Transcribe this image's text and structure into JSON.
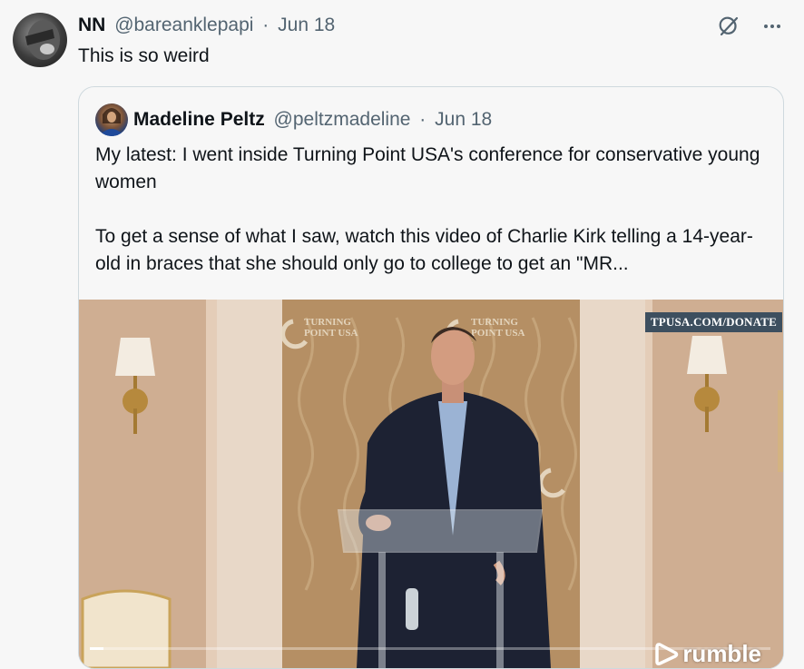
{
  "post": {
    "author_name": "NN",
    "author_handle": "@bareanklepapi",
    "separator": "·",
    "date": "Jun 18",
    "text": "This is so weird"
  },
  "quoted": {
    "author_name": "Madeline Peltz",
    "author_handle": "@peltzmadeline",
    "separator": "·",
    "date": "Jun 18",
    "text": "My latest: I went inside Turning Point USA's conference for conservative young women\n\nTo get a sense of what I saw, watch this video of Charlie Kirk telling a 14-year-old in braces that she should only go to college to get an \"MR..."
  },
  "video": {
    "watermark": "TPUSA.COM/DONATE",
    "platform_logo": "rumble",
    "progress": 0.02,
    "backdrop_text": [
      "TURNING",
      "POINT USA"
    ]
  },
  "icons": {
    "grok": "grok-slash-icon",
    "more": "more-horizontal-icon",
    "play": "rumble-play-icon"
  },
  "colors": {
    "background": "#f7f7f7",
    "text": "#0f1419",
    "muted": "#536471",
    "border": "#cfd9de"
  }
}
